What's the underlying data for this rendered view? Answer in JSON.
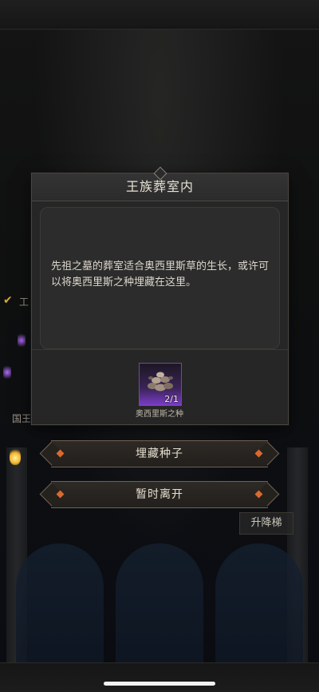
{
  "dialog": {
    "title": "王族葬室内",
    "description": "先祖之墓的葬室适合奥西里斯草的生长，或许可以将奥西里斯之种埋藏在这里。",
    "item": {
      "name": "奥西里斯之种",
      "count": "2/1",
      "icon": "seed-pile-icon"
    }
  },
  "actions": {
    "bury_label": "埋藏种子",
    "leave_label": "暂时离开"
  },
  "background": {
    "left_label_1": "工",
    "left_label_2": "国王",
    "elevator_label": "升降梯"
  },
  "colors": {
    "item_rarity": "#7b3cc8",
    "button_gem": "#d86a2c"
  }
}
